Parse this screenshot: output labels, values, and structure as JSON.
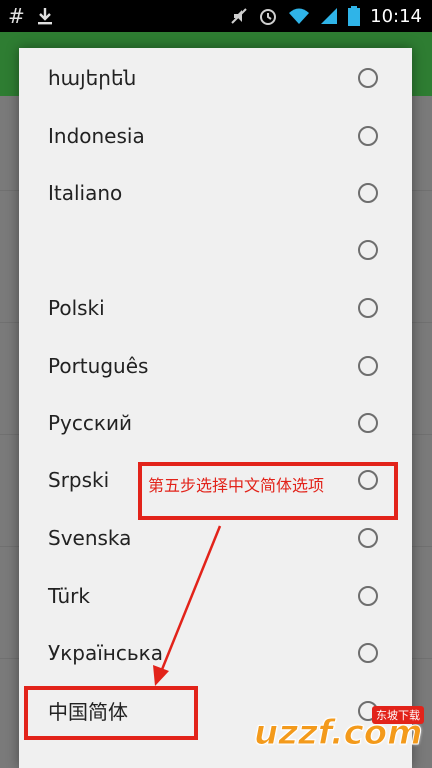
{
  "status_bar": {
    "hash_icon": "#",
    "time": "10:14"
  },
  "language_dialog": {
    "items": [
      {
        "label": "հայերեն"
      },
      {
        "label": "Indonesia"
      },
      {
        "label": "Italiano"
      },
      {
        "label": ""
      },
      {
        "label": "Polski"
      },
      {
        "label": "Português"
      },
      {
        "label": "Русский"
      },
      {
        "label": "Srpski"
      },
      {
        "label": "Svenska"
      },
      {
        "label": "Türk"
      },
      {
        "label": "Українська"
      },
      {
        "label": "中国简体"
      }
    ]
  },
  "annotation": {
    "text": "第五步选择中文简体选项",
    "color": "#e2231a"
  },
  "watermark": {
    "logo": "uzzf.com",
    "badge": "东坡下载"
  }
}
